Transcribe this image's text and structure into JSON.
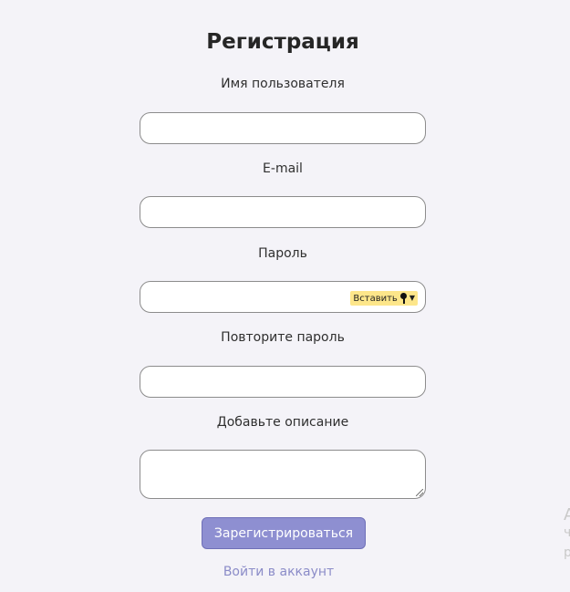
{
  "form": {
    "title": "Регистрация",
    "username_label": "Имя пользователя",
    "username_value": "",
    "email_label": "E-mail",
    "email_value": "",
    "password_label": "Пароль",
    "password_value": "",
    "password_paste_badge": "Вставить",
    "repeat_password_label": "Повторите пароль",
    "repeat_password_value": "",
    "description_label": "Добавьте описание",
    "description_value": "",
    "submit_label": "Зарегистрироваться",
    "login_link": "Войти в аккаунт"
  },
  "edge_text": {
    "line1": "А",
    "line2": "ч",
    "line3": "р"
  },
  "colors": {
    "accent": "#8e8fd1",
    "link": "#8b8cc8",
    "background": "#f4f3f8",
    "paste_badge": "#fde68a"
  }
}
